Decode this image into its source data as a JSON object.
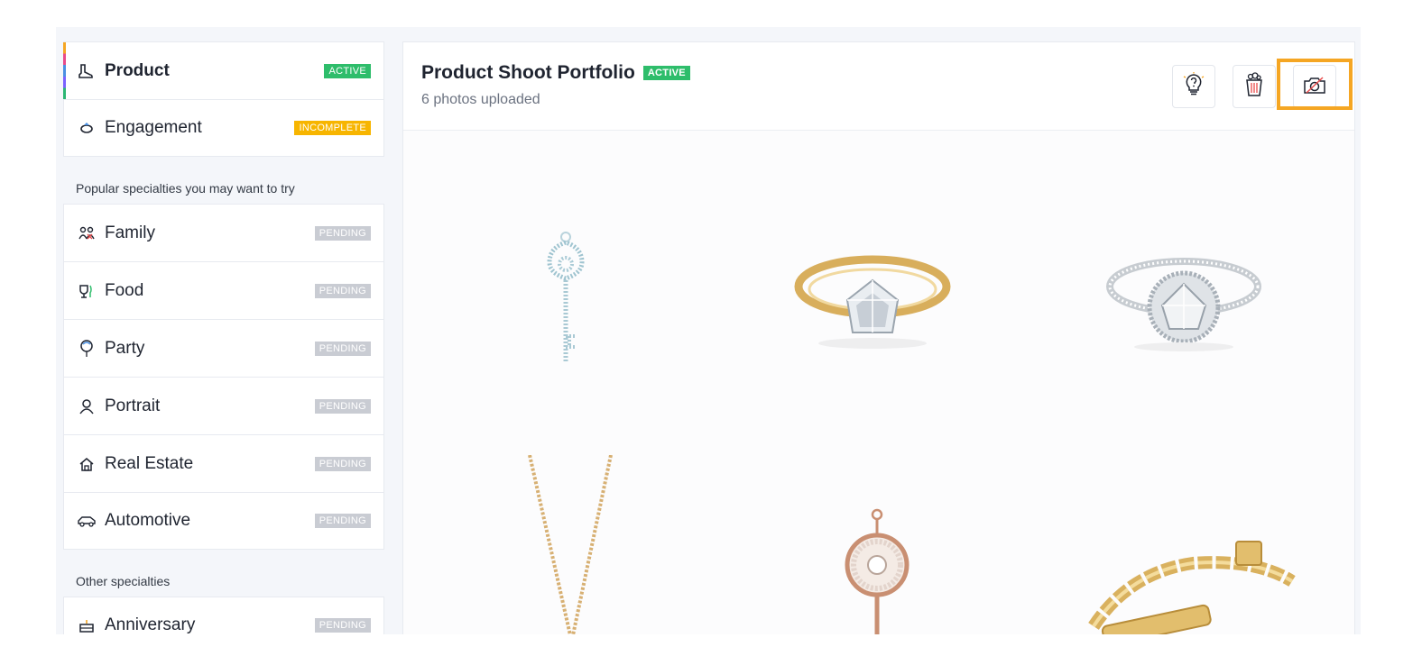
{
  "sidebar": {
    "primary": [
      {
        "label": "Product",
        "status": "ACTIVE",
        "icon": "boot-icon"
      },
      {
        "label": "Engagement",
        "status": "INCOMPLETE",
        "icon": "ring-icon"
      }
    ],
    "popular_heading": "Popular specialties you may want to try",
    "popular": [
      {
        "label": "Family",
        "status": "PENDING",
        "icon": "family-icon"
      },
      {
        "label": "Food",
        "status": "PENDING",
        "icon": "food-icon"
      },
      {
        "label": "Party",
        "status": "PENDING",
        "icon": "balloon-icon"
      },
      {
        "label": "Portrait",
        "status": "PENDING",
        "icon": "person-icon"
      },
      {
        "label": "Real Estate",
        "status": "PENDING",
        "icon": "house-icon"
      },
      {
        "label": "Automotive",
        "status": "PENDING",
        "icon": "car-icon"
      }
    ],
    "other_heading": "Other specialties",
    "other": [
      {
        "label": "Anniversary",
        "status": "PENDING",
        "icon": "cake-icon"
      }
    ]
  },
  "main": {
    "title": "Product Shoot Portfolio",
    "status": "ACTIVE",
    "subtitle": "6 photos uploaded",
    "actions": [
      {
        "name": "tips",
        "icon": "lightbulb-question-icon"
      },
      {
        "name": "delete",
        "icon": "trash-icon"
      },
      {
        "name": "hide",
        "icon": "camera-off-icon"
      }
    ],
    "photos": [
      {
        "subject": "key-pendant"
      },
      {
        "subject": "gold-solitaire-ring"
      },
      {
        "subject": "halo-diamond-ring"
      },
      {
        "subject": "gold-bead-chain"
      },
      {
        "subject": "rose-gold-key-pendant"
      },
      {
        "subject": "gold-chain-bracelet"
      }
    ]
  },
  "colors": {
    "active": "#2ebd6b",
    "incomplete": "#f7b500",
    "pending": "#c9ccd3",
    "highlight": "#f5a623"
  }
}
